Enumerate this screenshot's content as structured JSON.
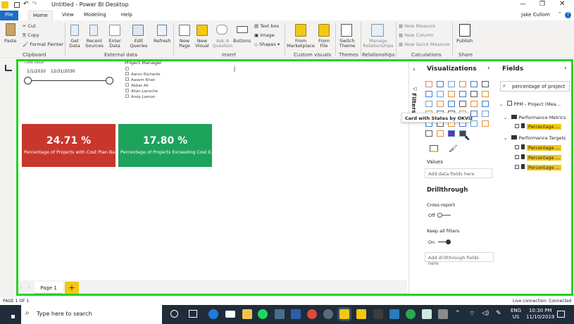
{
  "window": {
    "title": "Untitled - Power BI Desktop",
    "user": "Jake Cullom"
  },
  "tabs": [
    "File",
    "Home",
    "View",
    "Modeling",
    "Help"
  ],
  "ribbon": {
    "paste": "Paste",
    "cut": "Cut",
    "copy": "Copy",
    "format_painter": "Format Painter",
    "get_data": "Get Data",
    "recent_sources": "Recent Sources",
    "enter_data": "Enter Data",
    "edit_queries": "Edit Queries",
    "refresh": "Refresh",
    "new_page": "New Page",
    "new_visual": "New Visual",
    "ask_question": "Ask A Question",
    "buttons": "Buttons",
    "text_box": "Text box",
    "image": "Image",
    "shapes": "Shapes",
    "from_marketplace": "From Marketplace",
    "from_file": "From File",
    "switch_theme": "Switch Theme",
    "manage_relationships": "Manage Relationships",
    "new_measure": "New Measure",
    "new_column": "New Column",
    "new_quick_measure": "New Quick Measure",
    "publish": "Publish",
    "groups": [
      "Clipboard",
      "External data",
      "Insert",
      "Custom visuals",
      "Themes",
      "Relationships",
      "Calculations",
      "Share"
    ]
  },
  "slicer_date": {
    "label": "Date Value",
    "start": "1/1/2010",
    "end": "12/31/2030"
  },
  "slicer_pm": {
    "label": "Project Manager",
    "items": [
      "Aaron Richards",
      "Aasem Khan",
      "Akbar Ali",
      "Allan Lansche",
      "Andy Lamon"
    ]
  },
  "cards": [
    {
      "value": "24.71 %",
      "label": "Percentage of Projects with Cost Plan Ba...",
      "color": "#c8372c"
    },
    {
      "value": "17.80 %",
      "label": "Percentage of Projects Exceeding Cost E...",
      "color": "#1ea35c"
    }
  ],
  "filters_label": "Filters",
  "visualizations": {
    "title": "Visualizations",
    "tooltip": "Card with States by OKViz",
    "values_label": "Values",
    "add_fields": "Add data fields here",
    "drillthrough": "Drillthrough",
    "cross_report": "Cross-report",
    "cross_report_state": "Off",
    "keep_filters": "Keep all filters",
    "keep_filters_state": "On",
    "add_drill": "Add drillthrough fields here"
  },
  "fields": {
    "title": "Fields",
    "search_value": "percentage of project",
    "table": "PPM - Project (Mea...",
    "folders": [
      {
        "name": "Performance Metrics",
        "items": [
          "Percentage ..."
        ]
      },
      {
        "name": "Performance Targets",
        "items": [
          "Percentage ...",
          "Percentage ...",
          "Percentage ..."
        ]
      }
    ]
  },
  "pages": {
    "current": "Page 1",
    "add": "+"
  },
  "status": {
    "page": "PAGE 1 OF 1",
    "connection": "Live connection: Connected"
  },
  "taskbar": {
    "search_placeholder": "Type here to search",
    "lang": "ENG",
    "region": "US",
    "time": "10:30 PM",
    "date": "11/10/2019"
  },
  "colors": {
    "accent": "#f2c811",
    "highlight": "#22d422"
  }
}
